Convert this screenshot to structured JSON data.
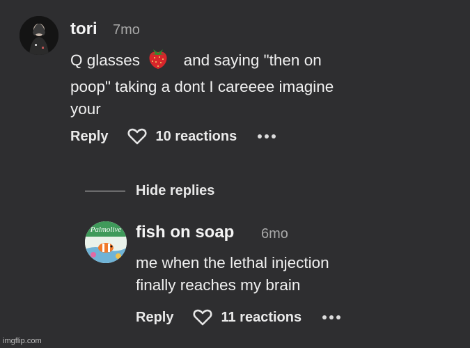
{
  "comment": {
    "username": "tori",
    "time": "7mo",
    "line1_before": "Q glasses",
    "line1_after": "and saying \"then on",
    "line2": "poop\" taking a dont I careeee imagine",
    "line3": "your",
    "reply_label": "Reply",
    "reactions": "10 reactions"
  },
  "replies_toggle": "Hide replies",
  "reply": {
    "username": "fish on soap",
    "time": "6mo",
    "line1": "me when the lethal injection",
    "line2": "finally reaches my brain",
    "reply_label": "Reply",
    "reactions": "11 reactions",
    "avatar_text": "Palmolive"
  },
  "watermark": "imgflip.com",
  "colors": {
    "background": "#2e2e30",
    "text": "#f0f0f0",
    "secondary": "#a8a8a8"
  },
  "icons": [
    "heart-icon",
    "more-icon",
    "strawberry-emoji"
  ]
}
